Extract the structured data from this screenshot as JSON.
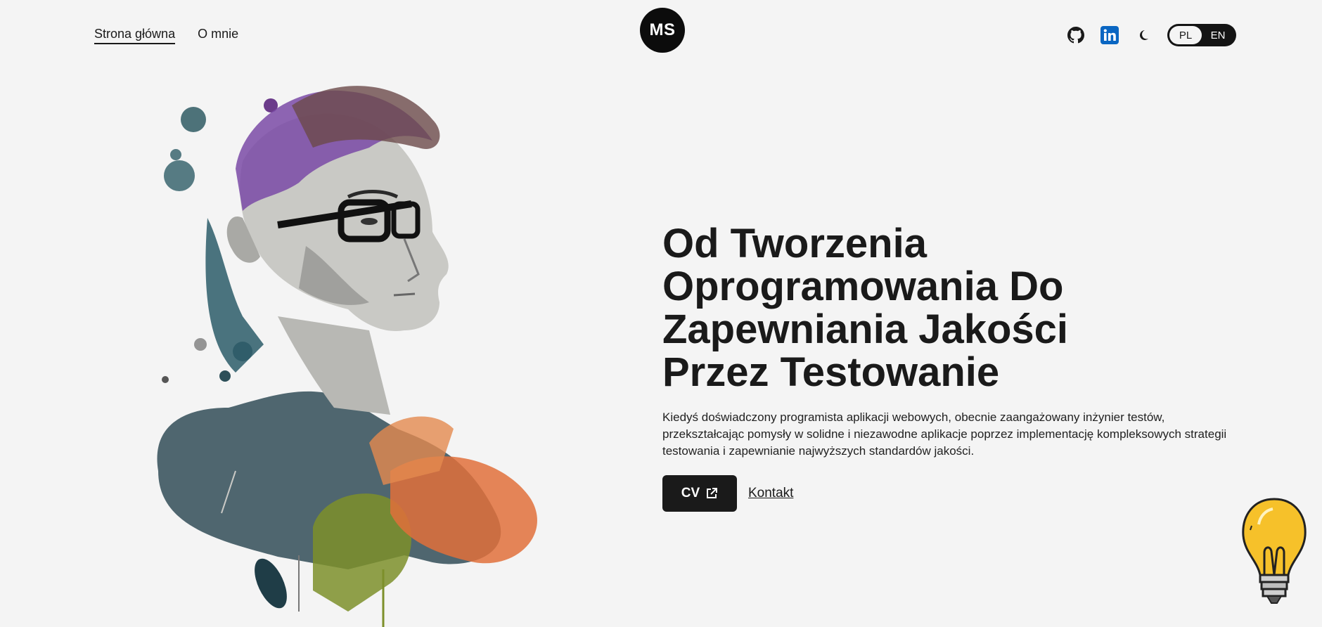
{
  "header": {
    "nav": [
      {
        "label": "Strona główna",
        "active": true
      },
      {
        "label": "O mnie",
        "active": false
      }
    ],
    "logo": "MS",
    "icons": [
      "github-icon",
      "linkedin-icon",
      "moon-icon"
    ],
    "lang": {
      "options": [
        "PL",
        "EN"
      ],
      "selected": "PL"
    }
  },
  "hero": {
    "title": [
      "Od Tworzenia",
      "Oprogramowania Do",
      "Zapewniania Jakości",
      "Przez Testowanie"
    ],
    "description": "Kiedyś doświadczony programista aplikacji webowych, obecnie zaangażowany inżynier testów, przekształcając pomysły w solidne i niezawodne aplikacje poprzez implementację kompleksowych strategii testowania i zapewnianie najwyższych standardów jakości.",
    "cv_label": "CV",
    "contact_label": "Kontakt"
  },
  "colors": {
    "background": "#f4f4f4",
    "text": "#1a1a1a",
    "linkedin": "#0a66c2",
    "bulb": "#f6c12a"
  }
}
